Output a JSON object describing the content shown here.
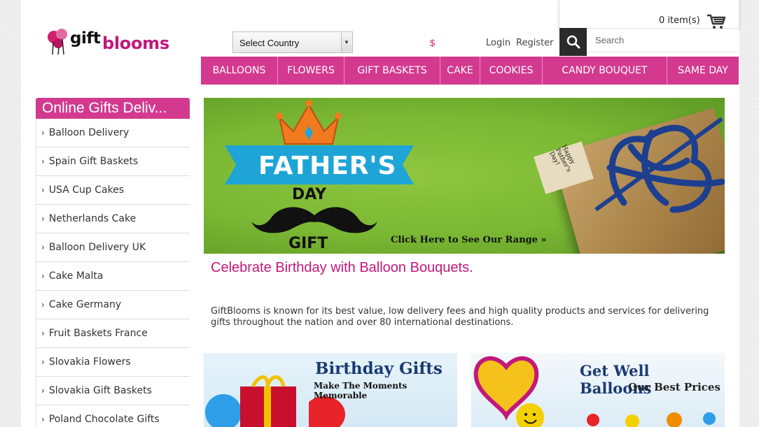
{
  "logo": {
    "part1": "gift",
    "part2": "blooms"
  },
  "header": {
    "country_select": "Select Country",
    "currency": "$",
    "login": "Login",
    "register": "Register",
    "cart": "0 item(s)",
    "search_placeholder": "Search"
  },
  "nav": [
    {
      "label": "BALLOONS"
    },
    {
      "label": "FLOWERS"
    },
    {
      "label": "GIFT BASKETS"
    },
    {
      "label": "CAKE"
    },
    {
      "label": "COOKIES"
    },
    {
      "label": "CANDY BOUQUET"
    },
    {
      "label": "SAME DAY"
    }
  ],
  "sidebar": {
    "title": "Online Gifts Deliv...",
    "items": [
      {
        "label": "Balloon Delivery"
      },
      {
        "label": "Spain Gift Baskets"
      },
      {
        "label": "USA Cup Cakes"
      },
      {
        "label": "Netherlands Cake"
      },
      {
        "label": "Balloon Delivery UK"
      },
      {
        "label": "Cake Malta"
      },
      {
        "label": "Cake Germany"
      },
      {
        "label": "Fruit Baskets France"
      },
      {
        "label": "Slovakia Flowers"
      },
      {
        "label": "Slovakia Gift Baskets"
      },
      {
        "label": "Poland Chocolate Gifts"
      }
    ]
  },
  "banner": {
    "ribbon": "FATHER'S",
    "day": "DAY",
    "gift": "GIFT",
    "cta": "Click Here to See Our Range »",
    "tag": "Happy Father's Day!"
  },
  "main": {
    "headline": "Celebrate Birthday with Balloon Bouquets.",
    "description": "GiftBlooms is known for its best value, low delivery fees and high quality products and services for delivering gifts throughout the nation and over 80 international destinations."
  },
  "promos": [
    {
      "title": "Birthday Gifts",
      "subtitle": "Make The Moments Memorable"
    },
    {
      "title": "Get Well Balloons",
      "subtitle": "Our Best Prices"
    }
  ],
  "colors": {
    "brand": "#d33a8f",
    "headline": "#c2187c",
    "banner": "#7ab733"
  }
}
